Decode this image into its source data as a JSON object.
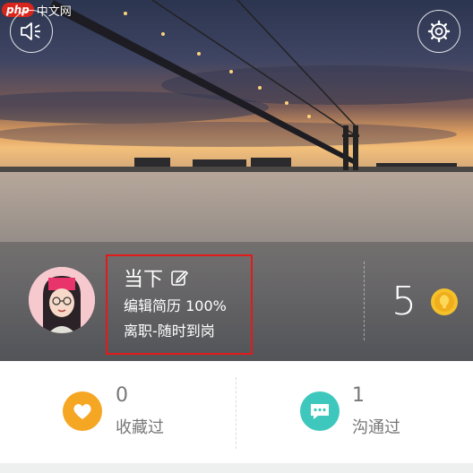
{
  "watermark": {
    "logo": "php",
    "text": "中文网"
  },
  "header": {
    "sound_icon": "speaker-icon",
    "settings_icon": "gear-icon"
  },
  "profile": {
    "name": "当下",
    "edit_icon": "edit-icon",
    "resume": "编辑简历 100%",
    "status": "离职-随时到岗",
    "coins": "5",
    "coin_icon": "gold-coin-icon"
  },
  "stats": {
    "favorited": {
      "count": "0",
      "label": "收藏过",
      "icon": "heart-icon",
      "color": "#f5a623"
    },
    "contacted": {
      "count": "1",
      "label": "沟通过",
      "icon": "chat-icon",
      "color": "#3ec8bd"
    }
  },
  "colors": {
    "highlight_box": "#e11a1a",
    "background": "#eef0f0"
  }
}
